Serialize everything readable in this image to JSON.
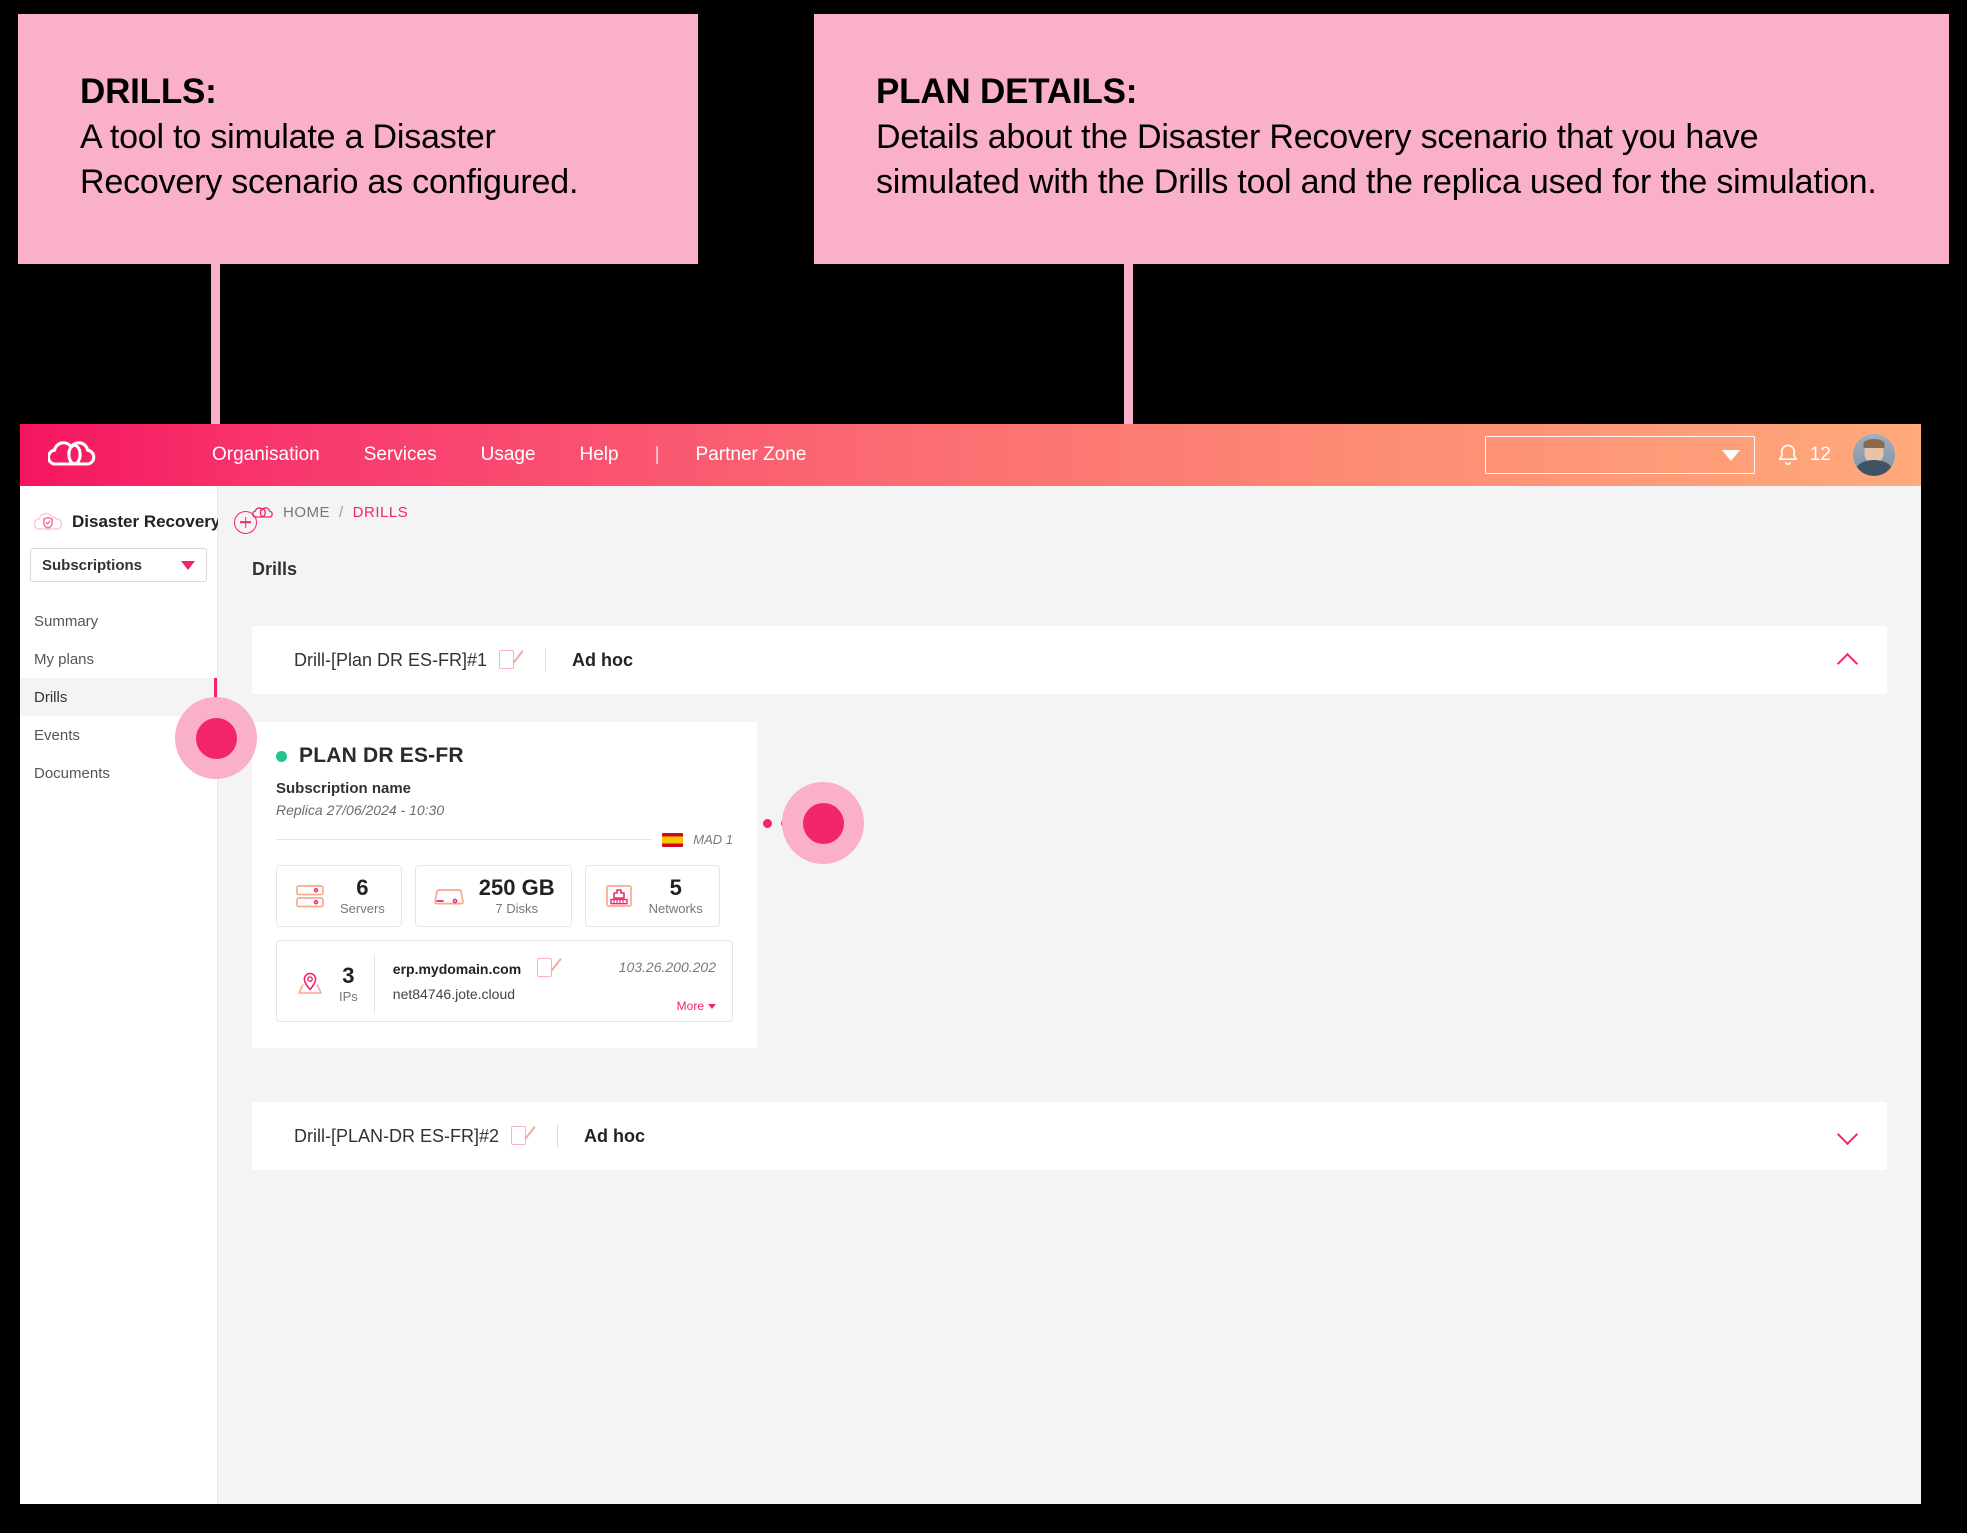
{
  "callouts": [
    {
      "id": "drills",
      "title": "DRILLS:",
      "body": "A tool to simulate a Disaster Recovery scenario as configured."
    },
    {
      "id": "plan-details",
      "title": "PLAN DETAILS:",
      "body": "Details about the Disaster Recovery scenario that you have simulated with the Drills tool and the replica used for the simulation."
    }
  ],
  "colors": {
    "accent_pink": "#F2256B",
    "callout_pink": "#F9B0C8",
    "header_gradient_start": "#F5155F",
    "header_gradient_end": "#FFA97C",
    "status_green": "#24C38E"
  },
  "topbar": {
    "logo": "cloud-logo",
    "links": [
      "Organisation",
      "Services",
      "Usage",
      "Help"
    ],
    "separator": "|",
    "partner_link": "Partner Zone",
    "selector_value": "",
    "notifications_count": "12",
    "avatar": "user-avatar"
  },
  "sidebar": {
    "service_icon": "cloud-shield-icon",
    "service_title": "Disaster Recovery",
    "add_button": "add-icon",
    "selector": {
      "value": "Subscriptions"
    },
    "items": [
      {
        "label": "Summary",
        "active": false
      },
      {
        "label": "My plans",
        "active": false
      },
      {
        "label": "Drills",
        "active": true
      },
      {
        "label": "Events",
        "active": false
      },
      {
        "label": "Documents",
        "active": false
      }
    ]
  },
  "breadcrumb": {
    "home": "HOME",
    "separator": "/",
    "current": "DRILLS"
  },
  "page_title": "Drills",
  "drills": [
    {
      "name": "Drill-[Plan DR ES-FR]#1",
      "mode": "Ad hoc",
      "expanded": true,
      "chevron": "chevron-up-icon"
    },
    {
      "name": "Drill-[PLAN-DR ES-FR]#2",
      "mode": "Ad hoc",
      "expanded": false,
      "chevron": "chevron-down-icon"
    }
  ],
  "plan": {
    "status": "active",
    "title": "PLAN DR ES-FR",
    "subscription_name": "Subscription name",
    "replica": "Replica 27/06/2024 - 10:30",
    "zone_flag": "spain-flag",
    "zone": "MAD 1",
    "stats": [
      {
        "icon": "server-icon",
        "value": "6",
        "label": "Servers"
      },
      {
        "icon": "disk-icon",
        "value": "250 GB",
        "label": "7 Disks"
      },
      {
        "icon": "network-icon",
        "value": "5",
        "label": "Networks"
      }
    ],
    "ips": {
      "icon": "map-pin-icon",
      "count": "3",
      "label": "IPs",
      "domain": "erp.mydomain.com",
      "hostname": "net84746.jote.cloud",
      "address": "103.26.200.202",
      "more_label": "More"
    }
  }
}
